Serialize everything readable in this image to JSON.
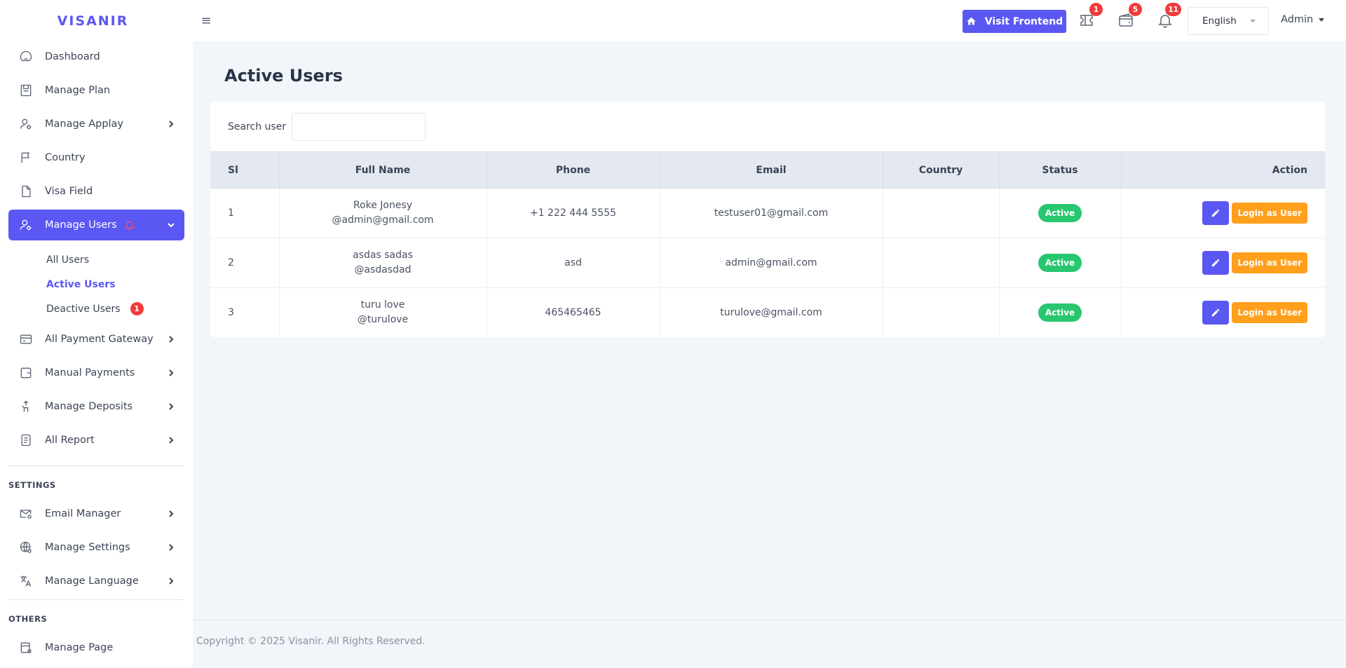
{
  "brand": "VISANIR",
  "sidebar": {
    "items": [
      {
        "label": "Dashboard",
        "icon": "dashboard-icon",
        "chevron": false
      },
      {
        "label": "Manage Plan",
        "icon": "plan-icon",
        "chevron": false
      },
      {
        "label": "Manage Applay",
        "icon": "user-gear-icon",
        "chevron": true
      },
      {
        "label": "Country",
        "icon": "flag-icon",
        "chevron": false
      },
      {
        "label": "Visa Field",
        "icon": "file-icon",
        "chevron": false
      },
      {
        "label": "Manage Users",
        "icon": "user-gear-icon",
        "chevron": true,
        "active": true
      }
    ],
    "users_submenu": [
      {
        "label": "All Users"
      },
      {
        "label": "Active Users",
        "current": true
      },
      {
        "label": "Deactive Users",
        "badge": "1"
      }
    ],
    "items_after": [
      {
        "label": "All Payment Gateway",
        "icon": "card-icon"
      },
      {
        "label": "Manual Payments",
        "icon": "wallet-icon"
      },
      {
        "label": "Manage Deposits",
        "icon": "deposit-icon"
      },
      {
        "label": "All Report",
        "icon": "report-icon"
      }
    ],
    "settings_title": "SETTINGS",
    "settings": [
      {
        "label": "Email Manager",
        "icon": "mail-gear-icon"
      },
      {
        "label": "Manage Settings",
        "icon": "globe-gear-icon"
      },
      {
        "label": "Manage Language",
        "icon": "translate-icon"
      }
    ],
    "others_title": "OTHERS",
    "others": [
      {
        "label": "Manage Page",
        "icon": "page-gear-icon"
      }
    ]
  },
  "header": {
    "visit_label": "Visit Frontend",
    "ticket_badge": "1",
    "wallet_badge": "5",
    "bell_badge": "11",
    "language": "English",
    "admin_label": "Admin"
  },
  "main": {
    "title": "Active Users",
    "search_label": "Search user",
    "search_value": "",
    "columns": [
      "Sl",
      "Full Name",
      "Phone",
      "Email",
      "Country",
      "Status",
      "Action"
    ],
    "rows": [
      {
        "sl": "1",
        "name": "Roke Jonesy",
        "username": "@admin@gmail.com",
        "phone": "+1 222 444 5555",
        "email": "testuser01@gmail.com",
        "country": "",
        "status": "Active"
      },
      {
        "sl": "2",
        "name": "asdas sadas",
        "username": "@asdasdad",
        "phone": "asd",
        "email": "admin@gmail.com",
        "country": "",
        "status": "Active"
      },
      {
        "sl": "3",
        "name": "turu love",
        "username": "@turulove",
        "phone": "465465465",
        "email": "turulove@gmail.com",
        "country": "",
        "status": "Active"
      }
    ],
    "login_label": "Login as User"
  },
  "footer": "Copyright © 2025 Visanir. All Rights Reserved.",
  "colors": {
    "accent": "#5b57f3",
    "success": "#28c76f",
    "warning": "#ff9f1c",
    "danger": "#f03b3b"
  }
}
